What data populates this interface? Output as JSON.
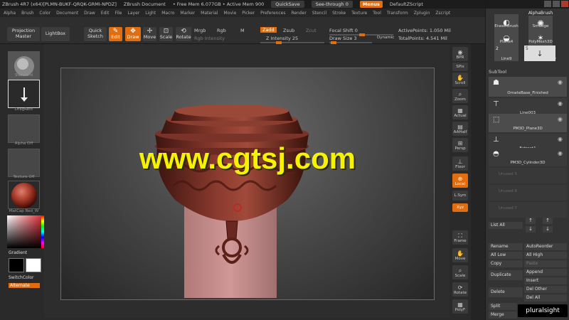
{
  "titlebar": {
    "app": "ZBrush 4R7 (x64)[PLMN-BUKF-QRQK-GRMI-NPDZ]",
    "doc": "ZBrush Document",
    "mem": "• Free Mem 6.077GB • Active Mem 900",
    "quicksave": "QuickSave",
    "seethrough": "See-through 0",
    "menus": "Menus",
    "script": "DefaultZScript"
  },
  "menubar": [
    "Alpha",
    "Brush",
    "Color",
    "Document",
    "Draw",
    "Edit",
    "File",
    "Layer",
    "Light",
    "Macro",
    "Marker",
    "Material",
    "Movie",
    "Picker",
    "Preferences",
    "Render",
    "Stencil",
    "Stroke",
    "Texture",
    "Tool",
    "Transform",
    "Zplugin",
    "Zscript"
  ],
  "toolbar": {
    "projection_master": "Projection Master",
    "lightbox": "LightBox",
    "quick_sketch": "Quick Sketch",
    "edit": "Edit",
    "draw": "Draw",
    "move": "Move",
    "scale": "Scale",
    "rotate": "Rotate",
    "mrgb": "Mrgb",
    "rgb": "Rgb",
    "m": "M",
    "zadd": "Zadd",
    "zsub": "Zsub",
    "zcut": "Zcut",
    "rgb_intensity": "Rgb Intensity",
    "z_intensity": "Z Intensity 25",
    "focal_shift": "Focal Shift 0",
    "draw_size": "Draw Size 3",
    "dynamic": "Dynamic",
    "active_points": "ActivePoints: 1.050 Mil",
    "total_points": "TotalPoints: 4.541 Mil"
  },
  "leftshelf": {
    "brush_caption": "Standard",
    "stroke_caption": "DragRect",
    "alpha_caption": "Alpha Off",
    "texture_caption": "Texture Off",
    "material_caption": "MatCap Red_W",
    "gradient": "Gradient",
    "switchcolor": "SwitchColor",
    "alternate": "Alternate"
  },
  "canvas": {
    "watermark": "www.cgtsj.com"
  },
  "rightcol": [
    "BPR",
    "SPix",
    "Scroll",
    "Zoom",
    "Actual",
    "AAHalf",
    "Persp",
    "Floor",
    "Local",
    "L.Sym",
    "Xyz",
    "Frame",
    "Move",
    "Scale",
    "Rotate",
    "PolyF"
  ],
  "panel": {
    "top_items": [
      "EraserBrush",
      "AlphaBrush",
      "Smudge",
      "Plane4",
      "PolyMesh3D",
      "Line9",
      "PM3D_Plane3D"
    ],
    "top_counts": [
      "2",
      "5"
    ],
    "subtool_header": "SubTool",
    "subtools": [
      "OrnateBase_Finished",
      "Line003",
      "PM3D_Plane3D",
      "Extract1",
      "PM3D_Cylinder3D"
    ],
    "empty_rows": [
      "Unused 5",
      "Unused 6",
      "Unused 7"
    ],
    "list_all": "List All",
    "buttons": [
      "Rename",
      "AutoReorder",
      "All Low",
      "All High",
      "Copy",
      "Paste",
      "Duplicate",
      "Append",
      "Insert",
      "Delete",
      "Del Other",
      "Del All",
      "Split",
      "Merge"
    ],
    "pluralsight": "pluralsight"
  }
}
